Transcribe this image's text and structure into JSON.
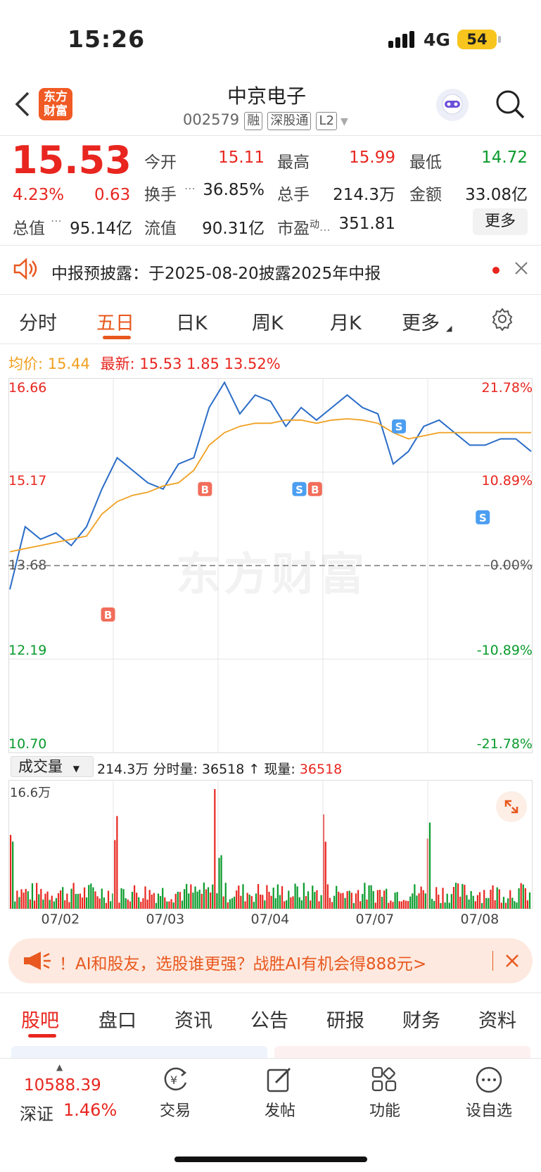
{
  "status": {
    "time": "15:26",
    "network": "4G",
    "battery": "54"
  },
  "header": {
    "logo_line1": "东方",
    "logo_line2": "财富",
    "title": "中京电子",
    "code": "002579",
    "tags": [
      "融",
      "深股通",
      "L2"
    ]
  },
  "quote": {
    "price": "15.53",
    "pct": "4.23%",
    "change": "0.63",
    "open_label": "今开",
    "open": "15.11",
    "high_label": "最高",
    "high": "15.99",
    "low_label": "最低",
    "low": "14.72",
    "turnover_label": "换手",
    "turnover": "36.85%",
    "volume_label": "总手",
    "volume": "214.3万",
    "amount_label": "金额",
    "amount": "33.08亿",
    "mktcap_label": "总值",
    "mktcap": "95.14亿",
    "float_label": "流值",
    "float": "90.31亿",
    "pe_label": "市盈",
    "pe_sup": "动",
    "pe": "351.81",
    "more": "更多"
  },
  "notice": {
    "text": "中报预披露：于2025-08-20披露2025年中报"
  },
  "chart_tabs": [
    "分时",
    "五日",
    "日K",
    "周K",
    "月K",
    "更多"
  ],
  "chart_info": {
    "avg_label": "均价:",
    "avg": "15.44",
    "latest_label": "最新:",
    "latest": "15.53",
    "latest_change": "1.85",
    "latest_pct": "13.52%"
  },
  "chart_data": {
    "type": "line",
    "x": [
      "07/02",
      "07/03",
      "07/04",
      "07/07",
      "07/08"
    ],
    "ylim": [
      10.7,
      16.66
    ],
    "y_ticks": [
      "16.66",
      "15.17",
      "13.68",
      "12.19",
      "10.70"
    ],
    "pct_ticks": [
      "21.78%",
      "10.89%",
      "0.00%",
      "-10.89%",
      "-21.78%"
    ],
    "prev_close": 13.68,
    "series": [
      {
        "values": [
          13.3,
          14.3,
          14.1,
          14.2,
          14.0,
          14.3,
          14.9,
          15.4,
          15.2,
          15.0,
          14.9,
          15.3,
          15.4,
          16.2,
          16.6,
          16.1,
          16.4,
          16.3,
          15.9,
          16.2,
          16.0,
          16.2,
          16.4,
          16.2,
          16.1,
          15.3,
          15.5,
          15.9,
          16.0,
          15.8,
          15.6,
          15.6,
          15.7,
          15.7,
          15.5
        ]
      },
      {
        "values": [
          13.9,
          13.95,
          14.0,
          14.05,
          14.1,
          14.15,
          14.5,
          14.7,
          14.8,
          14.85,
          14.95,
          15.0,
          15.2,
          15.6,
          15.8,
          15.9,
          15.95,
          15.95,
          16.0,
          16.0,
          15.95,
          16.0,
          16.02,
          16.0,
          15.95,
          15.8,
          15.7,
          15.75,
          15.8,
          15.8,
          15.8,
          15.8,
          15.8,
          15.8,
          15.8
        ]
      }
    ],
    "markers": [
      "B",
      "B",
      "S",
      "B",
      "S",
      "S"
    ],
    "volume_label": "成交量",
    "volume_total": "214.3万",
    "volume_info_label": "分时量:",
    "volume_info": "36518",
    "volume_now_label": "现量:",
    "volume_now": "36518",
    "volume_max": "16.6万"
  },
  "watermark": "东方财富",
  "banner": {
    "text": "！AI和股友，选股谁更强？战胜AI有机会得888元>"
  },
  "bottom_tabs": [
    "股吧",
    "盘口",
    "资讯",
    "公告",
    "研报",
    "财务",
    "资料"
  ],
  "dock": {
    "index_value": "10588.39",
    "index_name": "深证",
    "index_pct": "1.46%",
    "items": [
      "交易",
      "发帖",
      "功能",
      "设自选"
    ]
  },
  "colors": {
    "up": "#e8261f",
    "down": "#0a9b2c",
    "accent": "#e8581f",
    "price_line": "#2a6cc7",
    "avg_line": "#f0a020"
  }
}
